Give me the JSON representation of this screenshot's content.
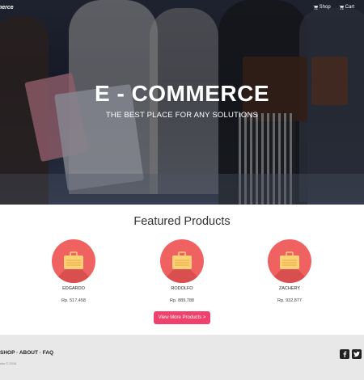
{
  "brand": "merce",
  "nav": {
    "shop": "Shop",
    "cart": "Cart"
  },
  "hero": {
    "title": "E - COMMERCE",
    "subtitle": "THE BEST PLACE FOR ANY SOLUTIONS"
  },
  "featured": {
    "title": "Featured Products",
    "products": [
      {
        "name": "EDGARDO",
        "price": "Rp. 517,458",
        "icon": "briefcase-icon"
      },
      {
        "name": "RODOLFO",
        "price": "Rp. 889,788",
        "icon": "briefcase-icon"
      },
      {
        "name": "ZACHERY",
        "price": "Rp. 932,877",
        "icon": "briefcase-icon"
      }
    ],
    "more_label": "View More Products >"
  },
  "footer": {
    "links": "SHOP · ABOUT · FAQ",
    "copyright": "ulio © 2016",
    "social": [
      "facebook-icon",
      "twitter-icon"
    ]
  },
  "colors": {
    "accent": "#f0416c",
    "product_circle": "#ef6261",
    "footer_bg": "#e8e8e8"
  }
}
